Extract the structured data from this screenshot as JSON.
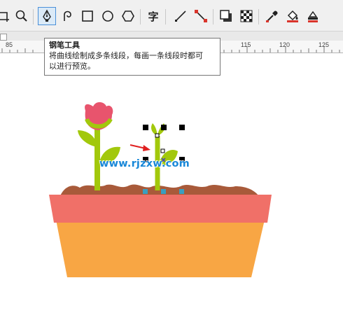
{
  "toolbar": {
    "tools": [
      {
        "name": "freehand-tool",
        "icon": "crop-icon"
      },
      {
        "name": "zoom-tool",
        "icon": "magnifier-icon"
      },
      {
        "name": "pen-tool",
        "icon": "pen-nib-icon",
        "active": true
      },
      {
        "name": "bspline-tool",
        "icon": "spiral-curve-icon"
      },
      {
        "name": "rectangle-tool",
        "icon": "rectangle-icon"
      },
      {
        "name": "ellipse-tool",
        "icon": "ellipse-icon"
      },
      {
        "name": "polygon-tool",
        "icon": "hexagon-icon"
      },
      {
        "name": "text-tool",
        "icon": "text-char-icon",
        "label": "字"
      },
      {
        "name": "parallel-dimension-tool",
        "icon": "diagonal-line-icon"
      },
      {
        "name": "connector-tool",
        "icon": "connector-icon"
      },
      {
        "name": "drop-shadow-tool",
        "icon": "shadow-square-icon"
      },
      {
        "name": "transparency-tool",
        "icon": "checkerboard-icon"
      },
      {
        "name": "eyedropper-tool",
        "icon": "eyedropper-icon"
      },
      {
        "name": "interactive-fill-tool",
        "icon": "paint-bucket-icon"
      },
      {
        "name": "smart-fill-tool",
        "icon": "fill-eraser-icon"
      }
    ]
  },
  "ruler": {
    "labels": [
      "85",
      "115",
      "120",
      "125"
    ]
  },
  "tooltip": {
    "title": "钢笔工具",
    "line1": "将曲线绘制成多条线段，每画一条线段时都可",
    "line2": "以进行预览。"
  },
  "watermark": {
    "text": "www.rjzxw.com"
  },
  "colors": {
    "flower": "#e8546d",
    "stem": "#a2c80c",
    "soil": "#a85a3a",
    "pot_rim": "#f07068",
    "pot_body": "#f8a644",
    "arrow": "#e02020",
    "node_cyan": "#3a9fc0"
  }
}
